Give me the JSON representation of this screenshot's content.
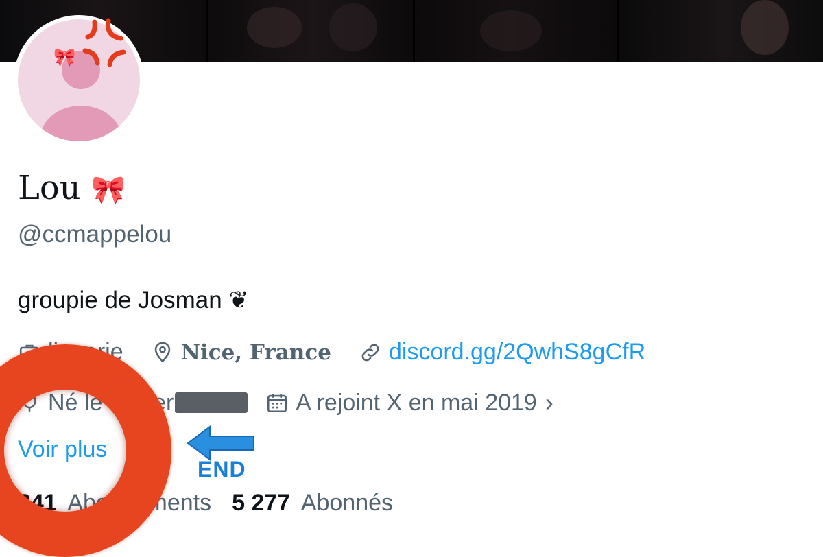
{
  "profile": {
    "name": "Lou",
    "name_emoji": "🎀",
    "handle": "@ccmappelou",
    "bio": "groupie de Josman ❦"
  },
  "meta": {
    "job": "lingerie",
    "location": "Nice, France",
    "link": "discord.gg/2QwhS8gCfR",
    "birthday": "Né le février",
    "joined": "A rejoint X en mai 2019"
  },
  "see_more": "Voir plus",
  "stats": {
    "following_count": "341",
    "following_label": "Abonnements",
    "followers_count": "5 277",
    "followers_label": "Abonnés"
  },
  "annotation": {
    "label": "END",
    "ring_color": "#e6451f",
    "arrow_color": "#2b8fe0"
  },
  "icons": [
    "briefcase-icon",
    "location-pin-icon",
    "link-icon",
    "balloon-icon",
    "calendar-icon",
    "chevron-right-icon",
    "anger-symbol-icon",
    "ribbon-bow-icon"
  ],
  "colors": {
    "link": "#1d9bf0",
    "secondary_text": "#536471",
    "primary_text": "#0f1419"
  }
}
